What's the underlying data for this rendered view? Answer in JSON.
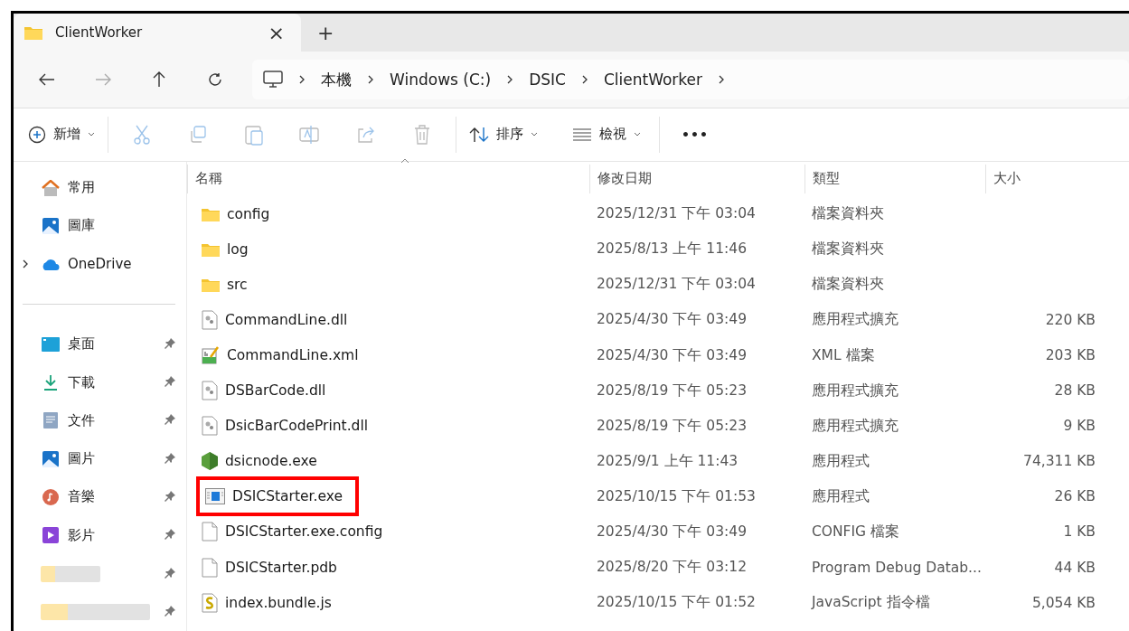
{
  "tab": {
    "title": "ClientWorker",
    "close": "×",
    "new_tab": "+"
  },
  "breadcrumb": [
    "本機",
    "Windows (C:)",
    "DSIC",
    "ClientWorker"
  ],
  "toolbar": {
    "new_label": "新增",
    "sort_label": "排序",
    "view_label": "檢視",
    "more": "•••"
  },
  "table": {
    "columns": [
      "名稱",
      "修改日期",
      "類型",
      "大小"
    ],
    "rows": [
      {
        "kind": "folder",
        "name": "config",
        "date": "2025/12/31 下午 03:04",
        "type": "檔案資料夾",
        "size": "",
        "highlighted": false
      },
      {
        "kind": "folder",
        "name": "log",
        "date": "2025/8/13 上午 11:46",
        "type": "檔案資料夾",
        "size": "",
        "highlighted": false
      },
      {
        "kind": "folder",
        "name": "src",
        "date": "2025/12/31 下午 03:04",
        "type": "檔案資料夾",
        "size": "",
        "highlighted": false
      },
      {
        "kind": "dll",
        "name": "CommandLine.dll",
        "date": "2025/4/30 下午 03:49",
        "type": "應用程式擴充",
        "size": "220 KB",
        "highlighted": false
      },
      {
        "kind": "xml",
        "name": "CommandLine.xml",
        "date": "2025/4/30 下午 03:49",
        "type": "XML 檔案",
        "size": "203 KB",
        "highlighted": false
      },
      {
        "kind": "dll",
        "name": "DSBarCode.dll",
        "date": "2025/8/19 下午 05:23",
        "type": "應用程式擴充",
        "size": "28 KB",
        "highlighted": false
      },
      {
        "kind": "dll",
        "name": "DsicBarCodePrint.dll",
        "date": "2025/8/19 下午 05:23",
        "type": "應用程式擴充",
        "size": "9 KB",
        "highlighted": false
      },
      {
        "kind": "node",
        "name": "dsicnode.exe",
        "date": "2025/9/1 上午 11:43",
        "type": "應用程式",
        "size": "74,311 KB",
        "highlighted": false
      },
      {
        "kind": "exe",
        "name": "DSICStarter.exe",
        "date": "2025/10/15 下午 01:53",
        "type": "應用程式",
        "size": "26 KB",
        "highlighted": true
      },
      {
        "kind": "blank",
        "name": "DSICStarter.exe.config",
        "date": "2025/4/30 下午 03:49",
        "type": "CONFIG 檔案",
        "size": "1 KB",
        "highlighted": false
      },
      {
        "kind": "blank",
        "name": "DSICStarter.pdb",
        "date": "2025/8/20 下午 03:12",
        "type": "Program Debug Datab...",
        "size": "44 KB",
        "highlighted": false
      },
      {
        "kind": "js",
        "name": "index.bundle.js",
        "date": "2025/10/15 下午 01:52",
        "type": "JavaScript 指令檔",
        "size": "5,054 KB",
        "highlighted": false
      }
    ]
  },
  "sidebar": {
    "top": [
      {
        "kind": "home",
        "label": "常用",
        "expandable": false
      },
      {
        "kind": "gallery",
        "label": "圖庫",
        "expandable": false
      },
      {
        "kind": "cloud",
        "label": "OneDrive",
        "expandable": true
      }
    ],
    "pinned": [
      {
        "kind": "desktop",
        "label": "桌面",
        "pinned": true
      },
      {
        "kind": "download",
        "label": "下載",
        "pinned": true
      },
      {
        "kind": "docs",
        "label": "文件",
        "pinned": true
      },
      {
        "kind": "pictures",
        "label": "圖片",
        "pinned": true
      },
      {
        "kind": "music",
        "label": "音樂",
        "pinned": true
      },
      {
        "kind": "video",
        "label": "影片",
        "pinned": true
      },
      {
        "kind": "redacted",
        "pinned": true
      },
      {
        "kind": "redacted-wide",
        "pinned": true
      }
    ]
  }
}
